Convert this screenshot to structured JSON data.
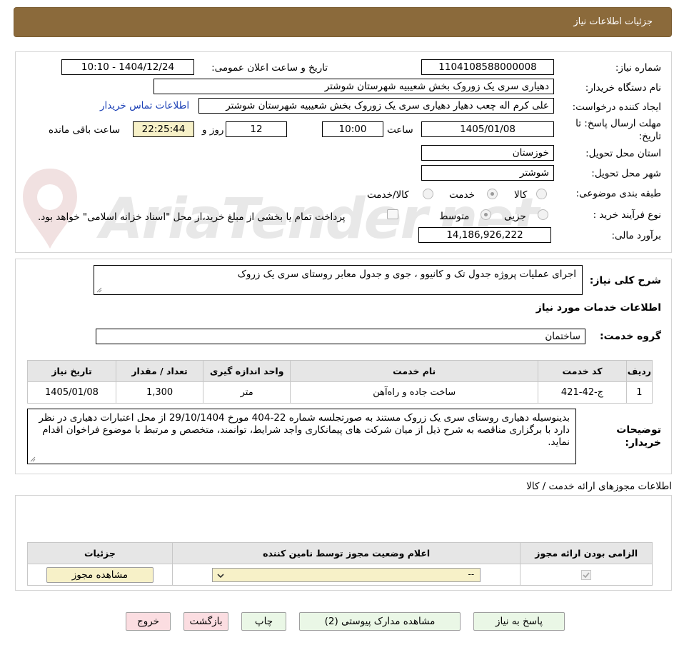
{
  "header": {
    "title": "جزئیات اطلاعات نیاز"
  },
  "watermark": "AriaTender.net",
  "details": {
    "need_number_label": "شماره نیاز:",
    "need_number": "1104108588000008",
    "announce_label": "تاریخ و ساعت اعلان عمومی:",
    "announce_value": "1404/12/24 - 10:10",
    "buyer_label": "نام دستگاه خریدار:",
    "buyer_value": "دهیاری سری یک زوروک بخش شعیبیه شهرستان شوشتر",
    "creator_label": "ایجاد کننده درخواست:",
    "creator_value": "علی کرم اله چعب دهیار دهیاری سری یک زوروک بخش شعیبیه شهرستان شوشتر",
    "contact_link": "اطلاعات تماس خریدار",
    "deadline_label_1": "مهلت ارسال پاسخ: تا",
    "deadline_label_2": "تاریخ:",
    "deadline_date": "1405/01/08",
    "time_label": "ساعت",
    "deadline_time": "10:00",
    "days_value": "12",
    "days_label": "روز و",
    "remaining_time": "22:25:44",
    "remaining_label": "ساعت باقی مانده",
    "province_label": "استان محل تحویل:",
    "province_value": "خوزستان",
    "city_label": "شهر محل تحویل:",
    "city_value": "شوشتر",
    "category_label": "طبقه بندی موضوعی:",
    "category_options": [
      "کالا",
      "خدمت",
      "کالا/خدمت"
    ],
    "category_selected": "خدمت",
    "process_label": "نوع فرآیند خرید :",
    "process_options": [
      "جزیی",
      "متوسط"
    ],
    "process_selected": "متوسط",
    "payment_note": "پرداخت تمام یا بخشی از مبلغ خرید،از محل \"اسناد خزانه اسلامی\" خواهد بود.",
    "budget_label": "برآورد مالی:",
    "budget_value": "14,186,926,222"
  },
  "description": {
    "label": "شرح کلی نیاز:",
    "value": "اجرای عملیات پروژه جدول تک و کانیوو ، جوی و جدول معابر روستای سری یک زروک"
  },
  "services": {
    "title": "اطلاعات خدمات مورد نیاز",
    "group_label": "گروه خدمت:",
    "group_value": "ساختمان",
    "columns": [
      "ردیف",
      "کد خدمت",
      "نام خدمت",
      "واحد اندازه گیری",
      "تعداد / مقدار",
      "تاریخ نیاز"
    ],
    "rows": [
      [
        "1",
        "ج-42-421",
        "ساخت جاده و راه‌آهن",
        "متر",
        "1,300",
        "1405/01/08"
      ]
    ]
  },
  "buyer_notes": {
    "label_1": "توضیحات",
    "label_2": "خریدار:",
    "value": "بدینوسیله دهیاری روستای سری یک زروک مستند به صورتجلسه شماره 22-404 مورخ 29/10/1404 از محل اعتبارات دهیاری در نظر دارد با برگزاری مناقصه به شرح ذیل از میان شرکت های پیمانکاری واجد شرایط، توانمند، متخصص و مرتبط با موضوع فراخوان اقدام نماید."
  },
  "licenses": {
    "title": "اطلاعات مجوزهای ارائه خدمت / کالا",
    "columns": [
      "الزامی بودن ارائه مجوز",
      "اعلام وضعیت مجوز توسط نامین کننده",
      "جزئیات"
    ],
    "select_value": "--",
    "view_button": "مشاهده مجوز"
  },
  "buttons": {
    "reply": "پاسخ به نیاز",
    "attachments": "مشاهده مدارک پیوستی (2)",
    "print": "چاپ",
    "back": "بازگشت",
    "exit": "خروج"
  }
}
